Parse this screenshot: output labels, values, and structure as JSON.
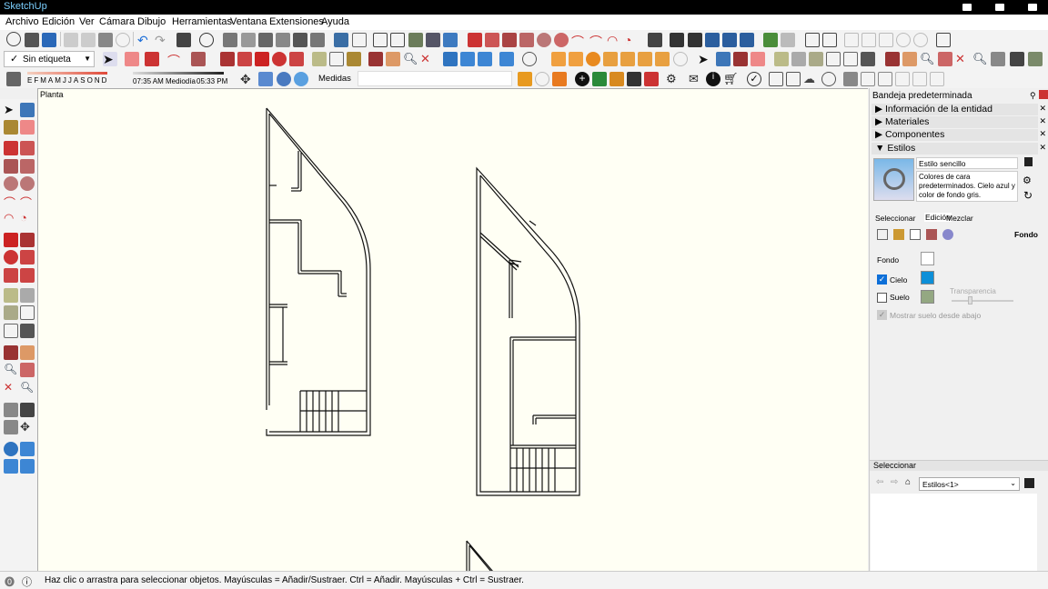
{
  "window": {
    "title": "SketchUp"
  },
  "menu": [
    "Archivo",
    "Edición",
    "Ver",
    "Cámara",
    "Dibujo",
    "Herramientas",
    "Ventana",
    "Extensiones",
    "Ayuda"
  ],
  "tag_selector": {
    "value": "Sin etiqueta"
  },
  "shadow_bar": {
    "months": [
      "E",
      "F",
      "M",
      "A",
      "M",
      "J",
      "J",
      "A",
      "S",
      "O",
      "N",
      "D"
    ],
    "time_start": "07:35 AM",
    "noon": "Mediodía",
    "time_end": "05:33 PM"
  },
  "measurements_label": "Medidas",
  "canvas": {
    "scene_label": "Planta"
  },
  "tray": {
    "title": "Bandeja predeterminada",
    "panels": [
      {
        "label": "Información de la entidad",
        "state": "collapsed"
      },
      {
        "label": "Materiales",
        "state": "collapsed"
      },
      {
        "label": "Componentes",
        "state": "collapsed"
      },
      {
        "label": "Estilos",
        "state": "expanded"
      }
    ],
    "style_name": "Estilo sencillo",
    "style_description": "Colores de cara predeterminados. Cielo azul y color de fondo gris.",
    "tabs": [
      "Seleccionar",
      "Edición",
      "Mezclar"
    ],
    "active_tab": "Edición",
    "section": "Fondo",
    "fondo_label": "Fondo",
    "fondo_color": "#ffffff",
    "cielo_label": "Cielo",
    "cielo_checked": true,
    "cielo_color": "#0d8fd8",
    "suelo_label": "Suelo",
    "suelo_checked": false,
    "suelo_color": "#94a882",
    "transparency_label": "Transparencia",
    "show_ground_label": "Mostrar suelo desde abajo",
    "select_section_title": "Seleccionar",
    "collection_value": "Estilos<1>"
  },
  "status": {
    "hint": "Haz clic o arrastra para seleccionar objetos. Mayúsculas = Añadir/Sustraer. Ctrl = Añadir. Mayúsculas + Ctrl = Sustraer."
  },
  "colors": {
    "canvas_bg": "#fffff4",
    "toolbar_bg": "#f3f3f3",
    "menu_bg": "#ffffff",
    "panel_header": "#e4e4e4"
  }
}
